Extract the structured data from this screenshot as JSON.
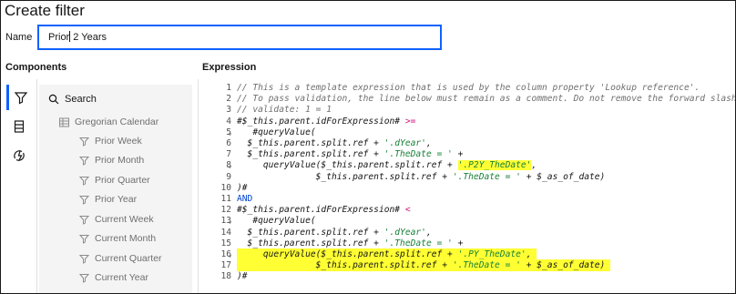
{
  "dialog": {
    "title": "Create filter"
  },
  "name_field": {
    "label": "Name",
    "value": "Prior 2 Years"
  },
  "sections": {
    "components": "Components",
    "expression": "Expression"
  },
  "rail_icons": [
    "filter-icon",
    "data-table-icon",
    "function-icon"
  ],
  "search": {
    "label": "Search"
  },
  "tree": {
    "root": "Gregorian Calendar",
    "items": [
      "Prior Week",
      "Prior Month",
      "Prior Quarter",
      "Prior Year",
      "Current Week",
      "Current Month",
      "Current Quarter",
      "Current Year"
    ]
  },
  "code_lines": [
    {
      "n": "1",
      "fold": "",
      "text": "// This is a template expression that is used by the column property 'Lookup reference'."
    },
    {
      "n": "2",
      "fold": "",
      "text": "// To pass validation, the line below must remain as a comment. Do not remove the forward slashes"
    },
    {
      "n": "3",
      "fold": "",
      "text": "// validate: 1 = 1"
    },
    {
      "n": "4",
      "fold": "",
      "text": "#$_this.parent.idForExpression# >="
    },
    {
      "n": "5",
      "fold": "v",
      "text": "   #queryValue("
    },
    {
      "n": "6",
      "fold": "",
      "text": "  $_this.parent.split.ref + '.dYear',"
    },
    {
      "n": "7",
      "fold": "",
      "text": "  $_this.parent.split.ref + '.TheDate = ' +"
    },
    {
      "n": "8",
      "fold": "v",
      "text": "     queryValue($_this.parent.split.ref + '.P2Y_TheDate',"
    },
    {
      "n": "9",
      "fold": "",
      "text": "               $_this.parent.split.ref + '.TheDate = ' + $_as_of_date)"
    },
    {
      "n": "10",
      "fold": "",
      "text": ")#"
    },
    {
      "n": "11",
      "fold": "",
      "text": "AND"
    },
    {
      "n": "12",
      "fold": "",
      "text": "#$_this.parent.idForExpression# <"
    },
    {
      "n": "13",
      "fold": "v",
      "text": "   #queryValue("
    },
    {
      "n": "14",
      "fold": "",
      "text": "  $_this.parent.split.ref + '.dYear',"
    },
    {
      "n": "15",
      "fold": "",
      "text": "  $_this.parent.split.ref + '.TheDate = ' +"
    },
    {
      "n": "16",
      "fold": "v",
      "text": "     queryValue($_this.parent.split.ref + '.PY_TheDate',"
    },
    {
      "n": "17",
      "fold": "",
      "text": "               $_this.parent.split.ref + '.TheDate = ' + $_as_of_date)"
    },
    {
      "n": "18",
      "fold": "",
      "text": ")#"
    }
  ],
  "colors": {
    "accent": "#0f62fe",
    "highlight": "#ffff33",
    "comment": "#6f6f6f",
    "keyword": "#0043ce"
  }
}
